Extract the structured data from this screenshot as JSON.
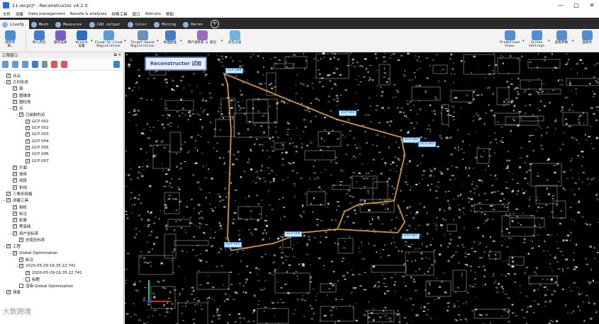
{
  "window": {
    "title": "11.recprj* - Reconstructor v4.2.0",
    "controls": [
      "—",
      "□",
      "✕"
    ]
  },
  "menu": [
    "文件",
    "测量",
    "Data management",
    "Results & analyses",
    "特殊工具",
    "窗口",
    "Add-ons",
    "帮助"
  ],
  "ribbon_tabs": [
    {
      "label": "Live3p",
      "active": true
    },
    {
      "label": "Mesh"
    },
    {
      "label": "Measures"
    },
    {
      "label": "CAD output"
    },
    {
      "label": "Color"
    },
    {
      "label": "Mining"
    },
    {
      "label": "Heron"
    }
  ],
  "ribbon_buttons": [
    {
      "label": "保存项目…",
      "color": "#4a8fd6"
    },
    {
      "label": "导入点云",
      "color": "#3d7fcf"
    },
    {
      "label": "顺序选择",
      "color": "#7a5cc8"
    },
    {
      "label": "Wizard\n设置",
      "color": "#2f6fc2"
    },
    {
      "label": "Cloud-to-cloud\nRegistration",
      "color": "#5a9bd8"
    },
    {
      "label": "Target-based\nRegistration",
      "color": "#6a8fb8"
    },
    {
      "label": "地理配准",
      "color": "#3f7dc6"
    },
    {
      "label": "用户坐标系 & 变位",
      "color": "#9a6cc0"
    },
    {
      "label": "点云过滤",
      "color": "#6fb3e0"
    }
  ],
  "ribbon_right": [
    {
      "label": "Predefined\nViews",
      "color": "#4f8ed0"
    },
    {
      "label": "Screen\nSettings",
      "color": "#4f8ed0"
    },
    {
      "label": "查看参数",
      "color": "#4f8ed0"
    },
    {
      "label": "选择点",
      "color": "#4f8ed0"
    }
  ],
  "panel": {
    "title": "工程窗口",
    "tree": [
      {
        "label": "点云",
        "depth": 0,
        "exp": "",
        "checked": true
      },
      {
        "label": "几何形状",
        "depth": 0,
        "exp": "⌄",
        "checked": true
      },
      {
        "label": "面",
        "depth": 1,
        "exp": "",
        "checked": true
      },
      {
        "label": "圆锥体",
        "depth": 1,
        "exp": "",
        "checked": true
      },
      {
        "label": "圆柱体",
        "depth": 1,
        "exp": "",
        "checked": true
      },
      {
        "label": "点",
        "depth": 1,
        "exp": "⌄",
        "checked": true
      },
      {
        "label": "已绘制的点",
        "depth": 2,
        "exp": "⌄",
        "checked": true
      },
      {
        "label": "GCP 001",
        "depth": 3,
        "exp": "",
        "checked": true
      },
      {
        "label": "GCP 002",
        "depth": 3,
        "exp": "",
        "checked": true
      },
      {
        "label": "GCP 003",
        "depth": 3,
        "exp": "",
        "checked": true
      },
      {
        "label": "GCP 004",
        "depth": 3,
        "exp": "",
        "checked": true
      },
      {
        "label": "GCP 005",
        "depth": 3,
        "exp": "",
        "checked": true
      },
      {
        "label": "GCP 006",
        "depth": 3,
        "exp": "",
        "checked": true
      },
      {
        "label": "GCP 007",
        "depth": 3,
        "exp": "",
        "checked": true
      },
      {
        "label": "平面",
        "depth": 1,
        "exp": "",
        "checked": true
      },
      {
        "label": "球体",
        "depth": 1,
        "exp": "",
        "checked": true
      },
      {
        "label": "线段",
        "depth": 1,
        "exp": "",
        "checked": true
      },
      {
        "label": "折线",
        "depth": 1,
        "exp": "",
        "checked": true
      },
      {
        "label": "三角形网格",
        "depth": 0,
        "exp": "",
        "checked": true
      },
      {
        "label": "测量工具",
        "depth": 0,
        "exp": "⌄",
        "checked": true
      },
      {
        "label": "相机",
        "depth": 1,
        "exp": "",
        "checked": true
      },
      {
        "label": "标注",
        "depth": 1,
        "exp": "",
        "checked": true
      },
      {
        "label": "影像",
        "depth": 1,
        "exp": "",
        "checked": true
      },
      {
        "label": "等高线",
        "depth": 1,
        "exp": "",
        "checked": true
      },
      {
        "label": "用户坐标系",
        "depth": 1,
        "exp": "⌄",
        "checked": true
      },
      {
        "label": "全局坐标系",
        "depth": 2,
        "exp": "",
        "checked": true
      },
      {
        "label": "工程",
        "depth": 0,
        "exp": "⌄",
        "checked": true
      },
      {
        "label": "Global Optimization",
        "depth": 1,
        "exp": "⌄",
        "checked": true
      },
      {
        "label": "标注",
        "depth": 2,
        "exp": "",
        "checked": true
      },
      {
        "label": "2020-05-29-16.35.22.741",
        "depth": 2,
        "exp": "⌄",
        "checked": true
      },
      {
        "label": "2020-05-29-16.35.22.741",
        "depth": 3,
        "exp": "",
        "checked": true
      },
      {
        "label": "标靶",
        "depth": 3,
        "exp": "›",
        "checked": false
      },
      {
        "label": "渲染-Global Optimization",
        "depth": 2,
        "exp": "",
        "checked": false
      },
      {
        "label": "场景",
        "depth": 0,
        "exp": "›",
        "checked": true
      }
    ]
  },
  "viewport": {
    "watermark": "Reconstructor 试验",
    "gcp_labels": [
      "GCP 004",
      "GCP 003",
      "GCP 002",
      "GCP 001",
      "GCP 007",
      "GCP 006",
      "GCP 005"
    ],
    "bottom_logo": "大数跨境"
  },
  "colors": {
    "accent": "#2a6fd1",
    "trajectory": "#e0a050",
    "gcp_label_bg": "#cde9ff"
  }
}
